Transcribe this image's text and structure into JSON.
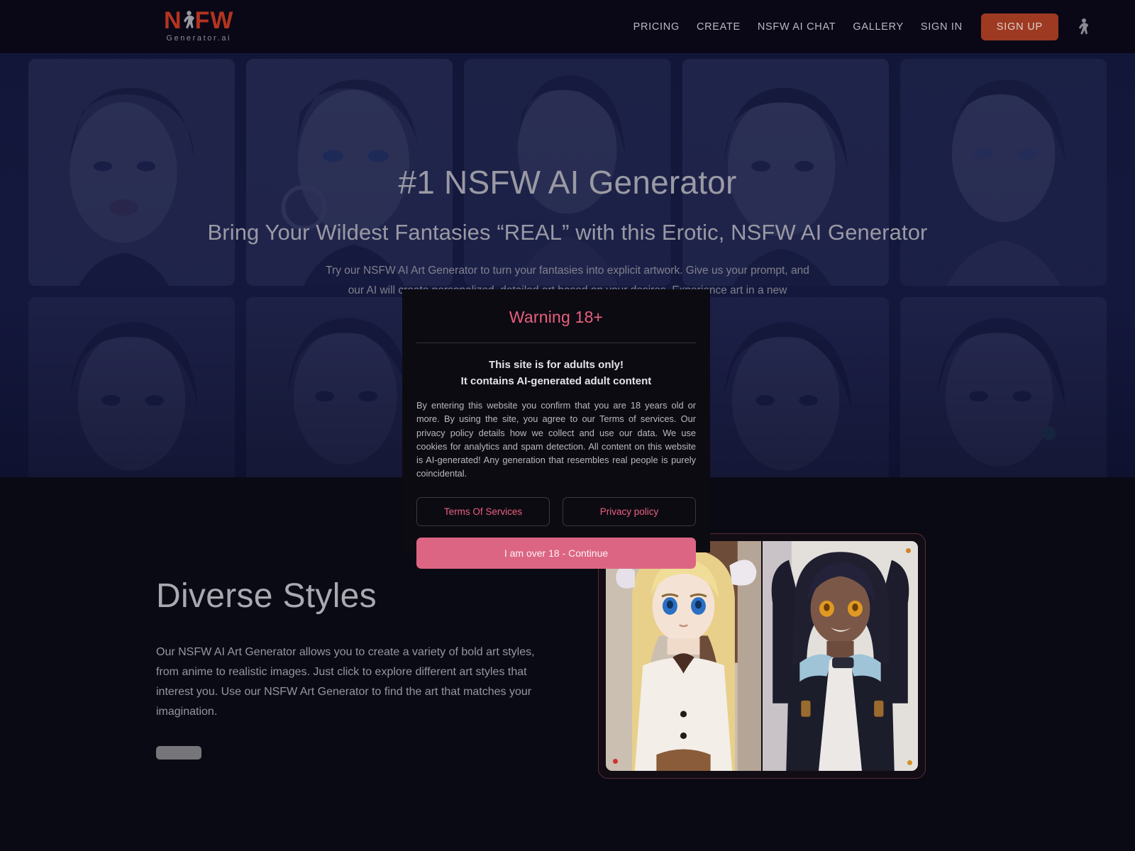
{
  "header": {
    "logo": {
      "main": "NSFW",
      "sub": "Generator.ai",
      "figure_icon": "person-figure-icon"
    },
    "nav": [
      {
        "label": "PRICING",
        "name": "nav-pricing"
      },
      {
        "label": "CREATE",
        "name": "nav-create"
      },
      {
        "label": "NSFW AI CHAT",
        "name": "nav-nsfw-ai-chat"
      },
      {
        "label": "GALLERY",
        "name": "nav-gallery"
      },
      {
        "label": "SIGN IN",
        "name": "nav-sign-in"
      }
    ],
    "signup_label": "SIGN UP",
    "user_icon": "user-avatar-icon"
  },
  "hero": {
    "title": "#1 NSFW AI Generator",
    "subtitle": "Bring Your Wildest Fantasies “REAL” with this Erotic, NSFW AI Generator",
    "paragraph": "Try our NSFW AI Art Generator to turn your fantasies into explicit artwork. Give us your prompt, and our AI will create personalized, detailed art based on your desires. Experience art in a new"
  },
  "section": {
    "title": "Diverse Styles",
    "body": "Our NSFW AI Art Generator allows you to create a variety of bold art styles, from anime to realistic images. Just click to explore different art styles that interest you. Use our NSFW Art Generator to find the art that matches your imagination."
  },
  "modal": {
    "title": "Warning 18+",
    "subtitle_line1": "This site is for adults only!",
    "subtitle_line2": "It contains AI-generated adult content",
    "body": "By entering this website you confirm that you are 18 years old or more. By using the site, you agree to our Terms of services. Our privacy policy details how we collect and use our data. We use cookies for analytics and spam detection. All content on this website is AI-generated! Any generation that resembles real people is purely coincidental.",
    "terms_label": "Terms Of Services",
    "privacy_label": "Privacy policy",
    "cta_label": "I am over 18 - Continue"
  },
  "colors": {
    "brand_red": "#b4341f",
    "signup_bg": "#9e3a22",
    "accent_pink": "#e8607f",
    "cta_pink": "#dd6584",
    "page_bg": "#0a0a14",
    "header_bg": "#0a0817",
    "modal_bg": "#0d0b12",
    "frame_border": "#5d2b33"
  }
}
